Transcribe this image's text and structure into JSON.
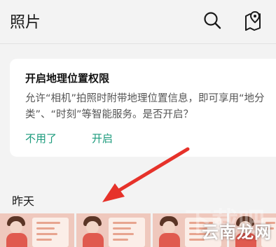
{
  "header": {
    "title": "照片",
    "icons": {
      "search": "search-icon",
      "map": "map-pin-icon"
    }
  },
  "card": {
    "title": "开启地理位置权限",
    "description": "允许“相机”拍照时附带地理位置信息，即可享用“地分类”、“时刻”等智能服务。是否开启？",
    "dismiss_label": "不用了",
    "enable_label": "开启",
    "accent_color": "#1a9a7b"
  },
  "gallery": {
    "section_label": "昨天",
    "thumbnails": [
      {
        "label": "photo-1"
      },
      {
        "label": "photo-2"
      },
      {
        "label": "photo-3"
      },
      {
        "label": "photo-4"
      }
    ]
  },
  "watermark": {
    "text": "云南龙网",
    "faded_text": "下载吧"
  }
}
